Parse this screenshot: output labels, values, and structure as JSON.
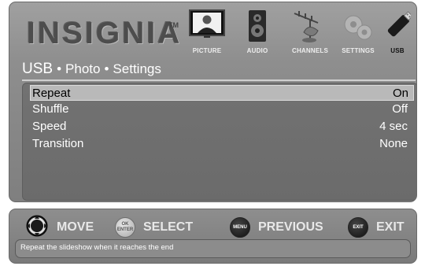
{
  "brand": {
    "name": "INSIGNIA",
    "trademark": "TM"
  },
  "menu_tabs": [
    {
      "label": "PICTURE",
      "icon": "tv-icon",
      "active": false
    },
    {
      "label": "AUDIO",
      "icon": "speaker-icon",
      "active": false
    },
    {
      "label": "CHANNELS",
      "icon": "antenna-icon",
      "active": false
    },
    {
      "label": "SETTINGS",
      "icon": "gears-icon",
      "active": false
    },
    {
      "label": "USB",
      "icon": "usb-stick-icon",
      "active": true
    }
  ],
  "breadcrumb": {
    "root": "USB",
    "level1": "Photo",
    "level2": "Settings",
    "separator": "•"
  },
  "settings": [
    {
      "label": "Repeat",
      "value": "On",
      "selected": true
    },
    {
      "label": "Shuffle",
      "value": "Off",
      "selected": false
    },
    {
      "label": "Speed",
      "value": "4 sec",
      "selected": false
    },
    {
      "label": "Transition",
      "value": "None",
      "selected": false
    }
  ],
  "nav_hints": {
    "move": "MOVE",
    "select": "SELECT",
    "previous": "PREVIOUS",
    "exit": "EXIT",
    "ok_button": [
      "OK",
      "ENTER"
    ],
    "menu_button": "MENU",
    "exit_button": "EXIT"
  },
  "help_text": "Repeat the slideshow when it reaches the end"
}
